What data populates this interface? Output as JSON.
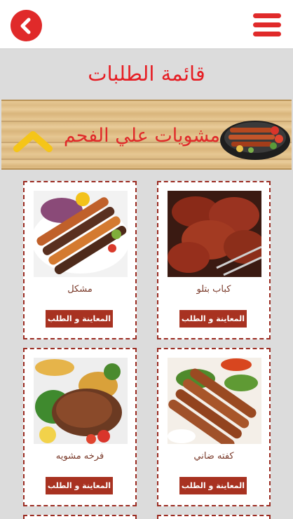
{
  "header": {
    "back_icon": "chevron-left-icon",
    "menu_icon": "hamburger-menu-icon",
    "accent_color": "#e02a2a"
  },
  "page": {
    "title": "قائمة الطلبات"
  },
  "category": {
    "title": "مشويات علي الفحم",
    "toggle_icon": "chevron-up-icon"
  },
  "items": [
    {
      "name": "كباب بتلو",
      "button": "المعاينة و الطلب"
    },
    {
      "name": "مشكل",
      "button": "المعاينة و الطلب"
    },
    {
      "name": "كفته ضاني",
      "button": "المعاينة و الطلب"
    },
    {
      "name": "فرخه مشويه",
      "button": "المعاينة و الطلب"
    }
  ]
}
